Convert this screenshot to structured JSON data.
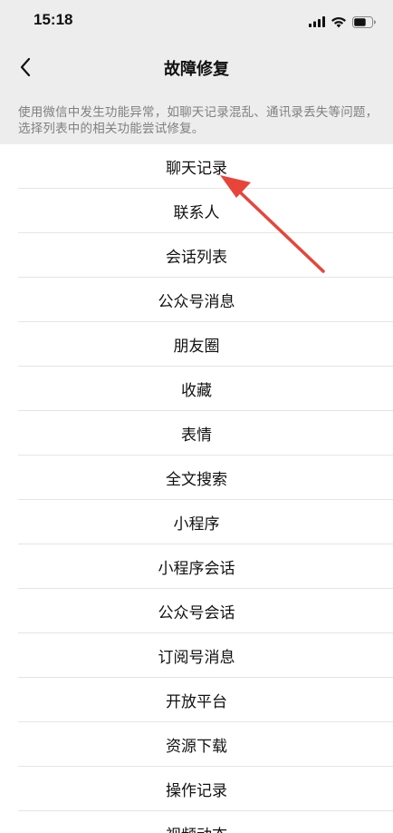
{
  "status": {
    "time": "15:18"
  },
  "nav": {
    "title": "故障修复",
    "back_icon": "chevron-left-icon"
  },
  "description": "使用微信中发生功能异常，如聊天记录混乱、通讯录丢失等问题，选择列表中的相关功能尝试修复。",
  "list": {
    "items": [
      {
        "label": "聊天记录"
      },
      {
        "label": "联系人"
      },
      {
        "label": "会话列表"
      },
      {
        "label": "公众号消息"
      },
      {
        "label": "朋友圈"
      },
      {
        "label": "收藏"
      },
      {
        "label": "表情"
      },
      {
        "label": "全文搜索"
      },
      {
        "label": "小程序"
      },
      {
        "label": "小程序会话"
      },
      {
        "label": "公众号会话"
      },
      {
        "label": "订阅号消息"
      },
      {
        "label": "开放平台"
      },
      {
        "label": "资源下载"
      },
      {
        "label": "操作记录"
      },
      {
        "label": "视频动态"
      }
    ]
  },
  "annotation": {
    "arrow_color": "#e8443a"
  }
}
